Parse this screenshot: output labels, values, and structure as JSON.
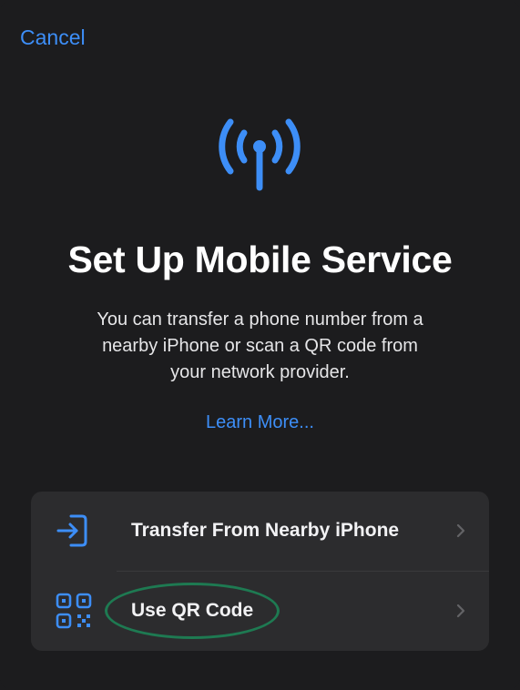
{
  "header": {
    "cancel_label": "Cancel"
  },
  "hero": {
    "icon": "antenna-icon",
    "title": "Set Up Mobile Service",
    "description": "You can transfer a phone number from a nearby iPhone or scan a QR code from your network provider.",
    "learn_more_label": "Learn More..."
  },
  "options": [
    {
      "icon": "transfer-icon",
      "label": "Transfer From Nearby iPhone"
    },
    {
      "icon": "qr-code-icon",
      "label": "Use QR Code"
    }
  ],
  "annotation": {
    "highlight_color": "#1e7a52",
    "highlighted_option": "Use QR Code"
  },
  "colors": {
    "accent": "#3d8ef7",
    "background": "#1c1c1e",
    "card": "#2c2c2e"
  }
}
